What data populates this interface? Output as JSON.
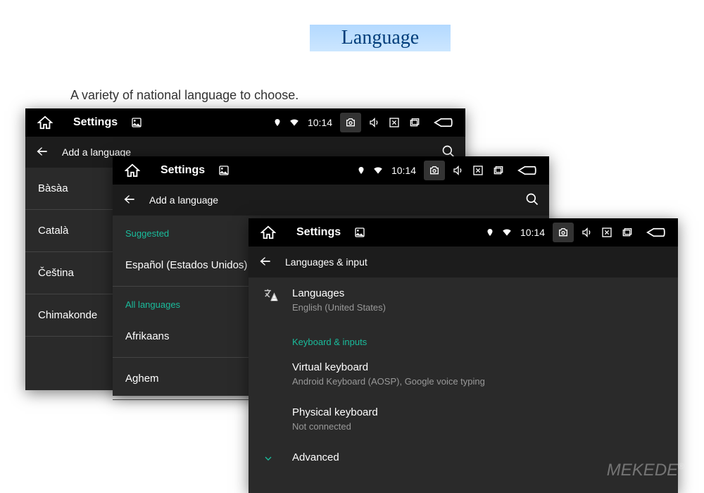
{
  "banner": {
    "title": "Language"
  },
  "subtitle": "A variety of national language to choose.",
  "sys": {
    "app": "Settings",
    "time": "10:14"
  },
  "panel1": {
    "header": "Add a language",
    "items": [
      "Bàsàa",
      "Català",
      "Čeština",
      "Chimakonde"
    ]
  },
  "panel2": {
    "header": "Add a language",
    "suggested_label": "Suggested",
    "suggested": [
      "Español (Estados Unidos)"
    ],
    "all_label": "All languages",
    "items": [
      "Afrikaans",
      "Aghem"
    ]
  },
  "panel3": {
    "header": "Languages & input",
    "languages": {
      "title": "Languages",
      "sub": "English (United States)"
    },
    "kb_section": "Keyboard & inputs",
    "vkb": {
      "title": "Virtual keyboard",
      "sub": "Android Keyboard (AOSP), Google voice typing"
    },
    "pkb": {
      "title": "Physical keyboard",
      "sub": "Not connected"
    },
    "adv": {
      "title": "Advanced"
    }
  },
  "watermark": "MEKEDE"
}
